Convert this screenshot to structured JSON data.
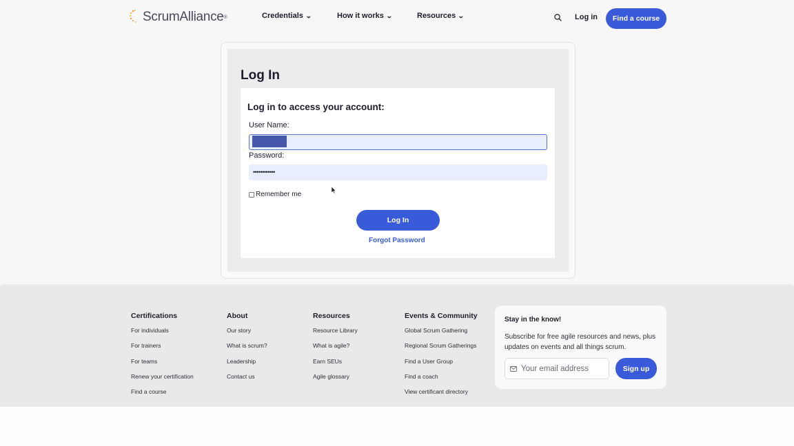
{
  "header": {
    "logo_text": "ScrumAlliance",
    "logo_reg": "®",
    "nav": [
      {
        "label": "Credentials"
      },
      {
        "label": "How it works"
      },
      {
        "label": "Resources"
      }
    ],
    "login_label": "Log in",
    "find_course_label": "Find a course",
    "icons": {
      "search": "search-icon",
      "chevron": "chevron-down-icon"
    }
  },
  "login": {
    "title": "Log In",
    "heading": "Log in to access your account:",
    "username_label": "User Name:",
    "username_value": "",
    "password_label": "Password:",
    "password_mask": "••••••••••••",
    "remember_label": "Remember me",
    "remember_checked": false,
    "submit_label": "Log In",
    "forgot_label": "Forgot Password"
  },
  "footer": {
    "columns": [
      {
        "title": "Certifications",
        "links": [
          "For individuals",
          "For trainers",
          "For teams",
          "Renew your certification",
          "Find a course"
        ]
      },
      {
        "title": "About",
        "links": [
          "Our story",
          "What is scrum?",
          "Leadership",
          "Contact us"
        ]
      },
      {
        "title": "Resources",
        "links": [
          "Resource Library",
          "What is agile?",
          "Earn SEUs",
          "Agile glossary"
        ]
      },
      {
        "title": "Events & Community",
        "links": [
          "Global Scrum Gathering",
          "Regional Scrum Gatherings",
          "Find a User Group",
          "Find a coach",
          "View certificant directory"
        ]
      }
    ],
    "newsletter": {
      "title": "Stay in the know!",
      "text": "Subscribe for free agile resources and news, plus updates on events and all things scrum.",
      "email_placeholder": "Your email address",
      "signup_label": "Sign up"
    }
  },
  "colors": {
    "accent": "#3a5bd9",
    "input_bg": "#e9eefc",
    "text": "#1d1d2b",
    "footer_bg": "#e9e9e9"
  }
}
